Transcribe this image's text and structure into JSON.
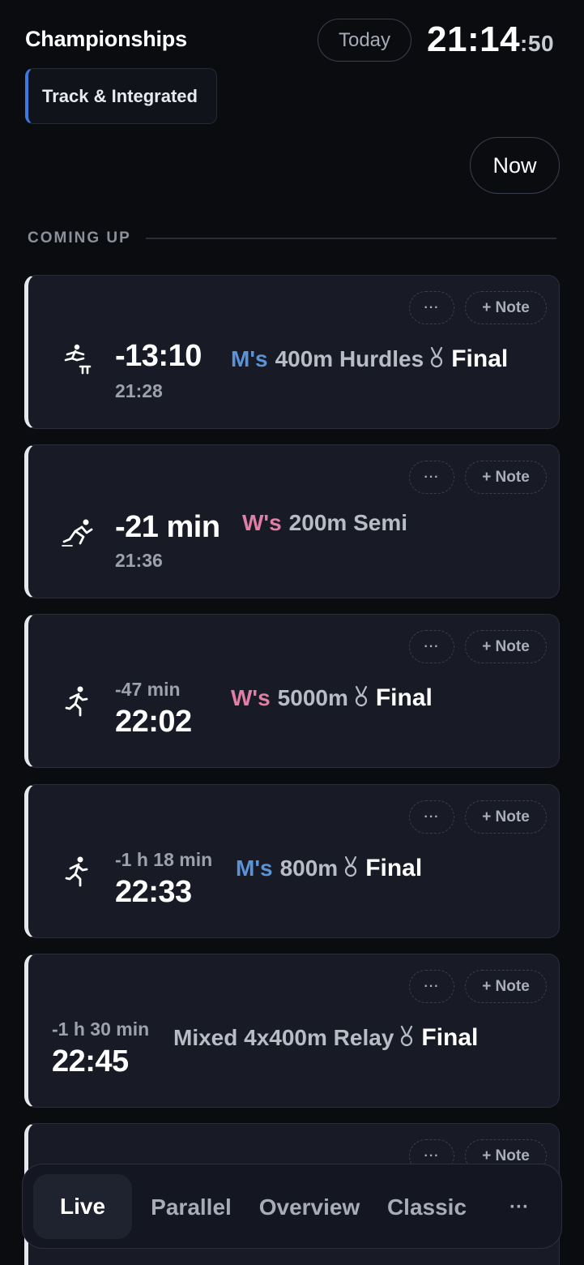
{
  "header": {
    "title": "Championships",
    "today_label": "Today",
    "clock_hm": "21:14",
    "clock_sec": ":50",
    "filter_label": "Track & Integrated",
    "now_label": "Now"
  },
  "section": {
    "label": "COMING UP"
  },
  "card_actions": {
    "more_label": "···",
    "note_label": "+ Note"
  },
  "events": [
    {
      "icon": "hurdles-icon",
      "countdown": "-13:10",
      "time": "21:28",
      "gender": "M's",
      "name": "400m Hurdles",
      "round": "Final",
      "medal": true
    },
    {
      "icon": "sprinter-icon",
      "countdown": "-21 min",
      "time": "21:36",
      "gender": "W's",
      "name": "200m Semi",
      "round": "",
      "medal": false
    },
    {
      "icon": "runner-icon",
      "countdown": "-47 min",
      "time": "22:02",
      "gender": "W's",
      "name": "5000m",
      "round": "Final",
      "medal": true
    },
    {
      "icon": "runner-icon",
      "countdown": "-1 h 18 min",
      "time": "22:33",
      "gender": "M's",
      "name": "800m",
      "round": "Final",
      "medal": true
    },
    {
      "icon": "",
      "countdown": "-1 h 30 min",
      "time": "22:45",
      "gender": "",
      "name": "Mixed 4x400m Relay",
      "round": "Final",
      "medal": true
    }
  ],
  "nav": {
    "live": "Live",
    "parallel": "Parallel",
    "overview": "Overview",
    "classic": "Classic",
    "more": "···"
  },
  "colors": {
    "accent_blue": "#3c7ae0",
    "men": "#5b93d9",
    "women": "#e07ea6",
    "card_bg": "#181b26",
    "page_bg": "#0b0c10"
  }
}
